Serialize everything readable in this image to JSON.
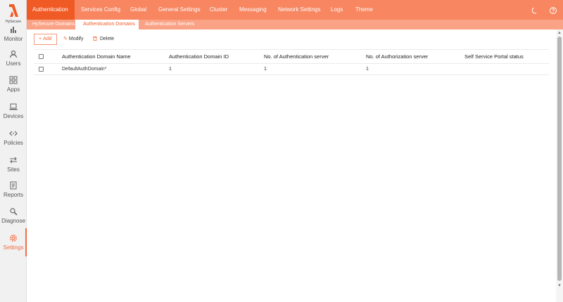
{
  "brand": {
    "logo_text": "HySecure",
    "accent": "#f26a3d",
    "topbar_color": "#f78661",
    "subbar_color": "#f9a285"
  },
  "sidebar": {
    "items": [
      {
        "label": "Monitor",
        "icon": "bar-chart-icon"
      },
      {
        "label": "Users",
        "icon": "user-icon"
      },
      {
        "label": "Apps",
        "icon": "apps-grid-icon"
      },
      {
        "label": "Devices",
        "icon": "laptop-icon"
      },
      {
        "label": "Policies",
        "icon": "code-arrows-icon"
      },
      {
        "label": "Sites",
        "icon": "swap-arrows-icon"
      },
      {
        "label": "Reports",
        "icon": "report-icon"
      },
      {
        "label": "Diagnose",
        "icon": "search-wrench-icon"
      },
      {
        "label": "Settings",
        "icon": "gear-icon",
        "active": true
      }
    ]
  },
  "topnav": {
    "tabs": [
      "Authentication",
      "Services Config",
      "Global",
      "General Settings",
      "Cluster",
      "Messaging",
      "Network Settings",
      "Logs",
      "Theme"
    ],
    "active": "Authentication",
    "right_icons": [
      "moon-icon",
      "help-icon"
    ]
  },
  "subnav": {
    "tabs": [
      "HySecure Domains",
      "Authentication Domains",
      "Authentication Servers"
    ],
    "active": "Authentication Domains"
  },
  "toolbar": {
    "add_label": "Add",
    "modify_label": "Modify",
    "delete_label": "Delete"
  },
  "table": {
    "columns": [
      "Authentication Domain Name",
      "Authentication Domain ID",
      "No. of Authentication server",
      "No. of Authorization server",
      "Self Service Portal status"
    ],
    "rows": [
      [
        "DefaultAuthDomain*",
        "1",
        "1",
        "1",
        ""
      ]
    ]
  }
}
